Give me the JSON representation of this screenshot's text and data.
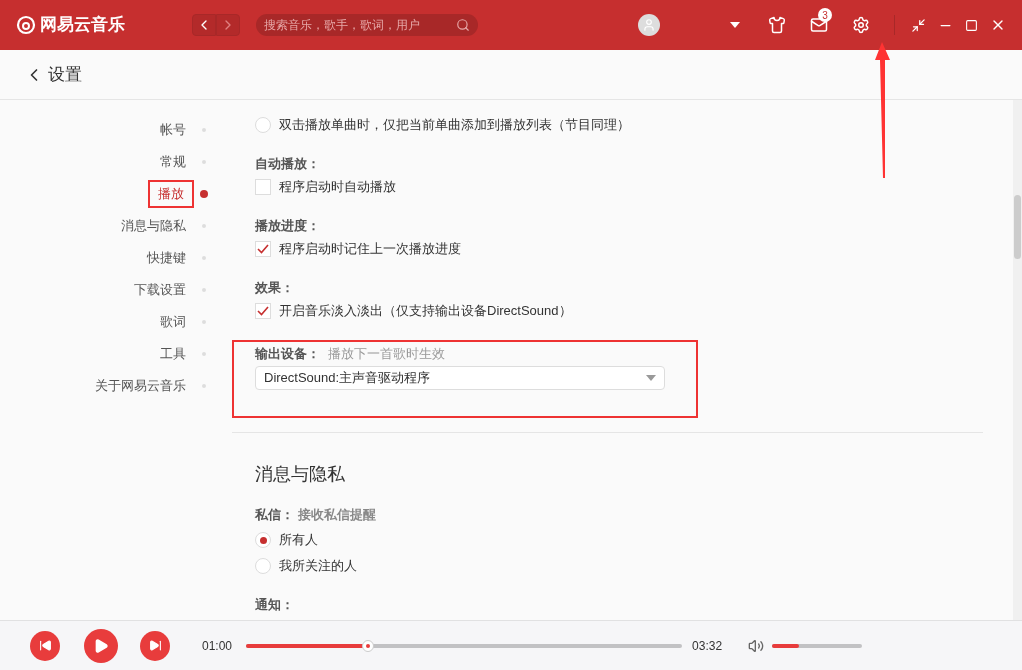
{
  "app": {
    "name": "网易云音乐"
  },
  "search": {
    "placeholder": "搜索音乐，歌手，歌词，用户"
  },
  "messages": {
    "badge": "3"
  },
  "page": {
    "title": "设置"
  },
  "sidebar": {
    "items": [
      {
        "label": "帐号",
        "selected": false
      },
      {
        "label": "常规",
        "selected": false
      },
      {
        "label": "播放",
        "selected": true
      },
      {
        "label": "消息与隐私",
        "selected": false
      },
      {
        "label": "快捷键",
        "selected": false
      },
      {
        "label": "下载设置",
        "selected": false
      },
      {
        "label": "歌词",
        "selected": false
      },
      {
        "label": "工具",
        "selected": false
      },
      {
        "label": "关于网易云音乐",
        "selected": false
      }
    ]
  },
  "play_options": [
    {
      "label": "双击播放单曲时，仅把当前单曲添加到播放列表（节目同理）",
      "selected": false
    }
  ],
  "groups": [
    {
      "title": "自动播放：",
      "options": [
        {
          "label": "程序启动时自动播放",
          "checked": false
        }
      ]
    },
    {
      "title": "播放进度：",
      "options": [
        {
          "label": "程序启动时记住上一次播放进度",
          "checked": true
        }
      ]
    },
    {
      "title": "效果：",
      "options": [
        {
          "label": "开启音乐淡入淡出（仅支持输出设备DirectSound）",
          "checked": true
        }
      ]
    }
  ],
  "output_device": {
    "title": "输出设备：",
    "hint": "播放下一首歌时生效",
    "value": "DirectSound:主声音驱动程序"
  },
  "privacy": {
    "title": "消息与隐私",
    "dm_title": "私信：",
    "dm_hint": "接收私信提醒",
    "options": [
      {
        "label": "所有人",
        "selected": true
      },
      {
        "label": "我所关注的人",
        "selected": false
      }
    ],
    "notify_title": "通知："
  },
  "player": {
    "elapsed": "01:00",
    "duration": "03:32",
    "level": 0.28,
    "volume": {
      "level": 0.3
    }
  }
}
